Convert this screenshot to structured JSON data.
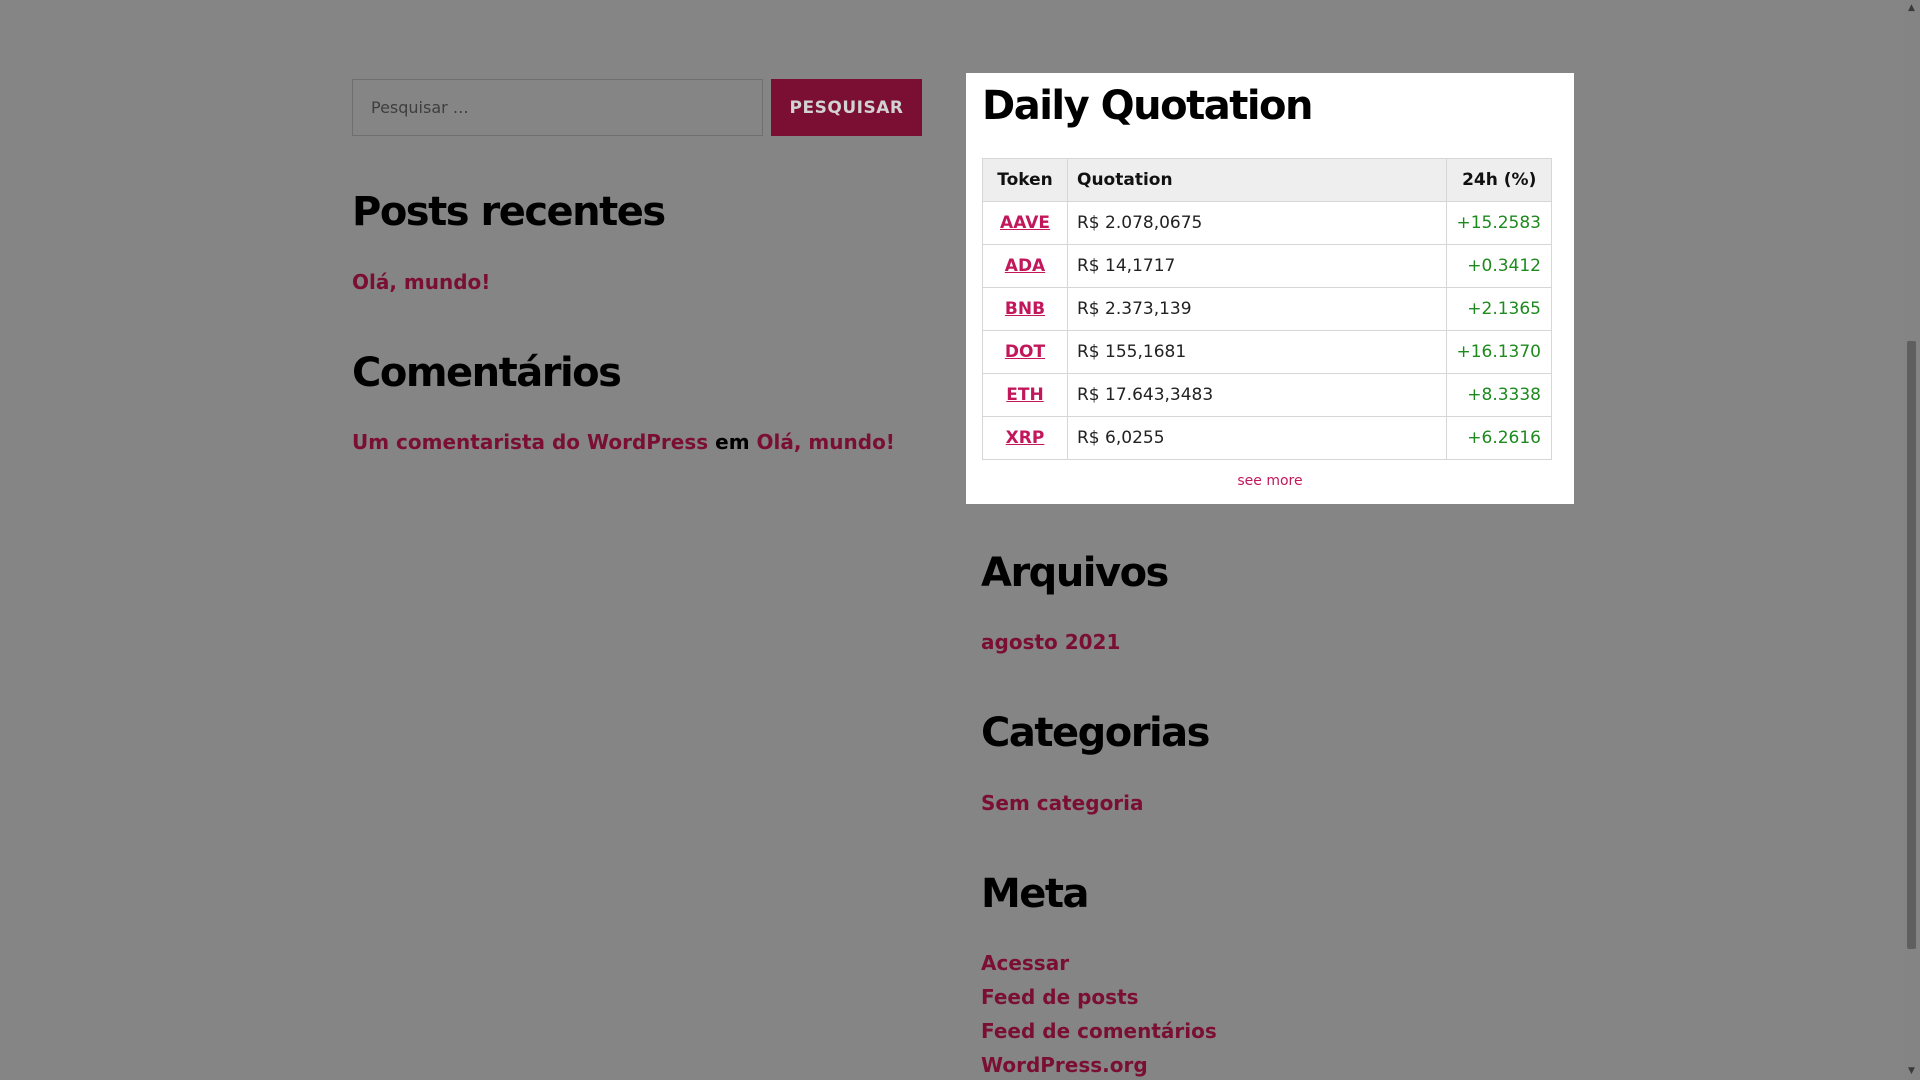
{
  "search": {
    "placeholder": "Pesquisar …",
    "button_label": "PESQUISAR"
  },
  "recent_posts": {
    "title": "Posts recentes",
    "items": [
      {
        "label": "Olá, mundo!"
      }
    ]
  },
  "comments": {
    "title": "Comentários",
    "author": "Um comentarista do WordPress",
    "separator": "em",
    "post": "Olá, mundo!"
  },
  "quotation": {
    "title": "Daily Quotation",
    "headers": {
      "token": "Token",
      "quotation": "Quotation",
      "change": "24h (%)"
    },
    "rows": [
      {
        "token": "AAVE",
        "quotation": "R$ 2.078,0675",
        "change": "+15.2583"
      },
      {
        "token": "ADA",
        "quotation": "R$ 14,1717",
        "change": "+0.3412"
      },
      {
        "token": "BNB",
        "quotation": "R$ 2.373,139",
        "change": "+2.1365"
      },
      {
        "token": "DOT",
        "quotation": "R$ 155,1681",
        "change": "+16.1370"
      },
      {
        "token": "ETH",
        "quotation": "R$ 17.643,3483",
        "change": "+8.3338"
      },
      {
        "token": "XRP",
        "quotation": "R$ 6,0255",
        "change": "+6.2616"
      }
    ],
    "see_more": "see more"
  },
  "archives": {
    "title": "Arquivos",
    "items": [
      {
        "label": "agosto 2021"
      }
    ]
  },
  "categories": {
    "title": "Categorias",
    "items": [
      {
        "label": "Sem categoria"
      }
    ]
  },
  "meta": {
    "title": "Meta",
    "items": [
      {
        "label": "Acessar"
      },
      {
        "label": "Feed de posts"
      },
      {
        "label": "Feed de comentários"
      },
      {
        "label": "WordPress.org"
      }
    ]
  },
  "colors": {
    "overlay_background": "#858585",
    "accent": "#7a0f33",
    "link_pink": "#c2185b",
    "positive_green": "#1e8a1e",
    "card_background": "#ffffff"
  },
  "scrollbar": {
    "up_icon": "triangle-up-icon",
    "down_icon": "triangle-down-icon"
  }
}
